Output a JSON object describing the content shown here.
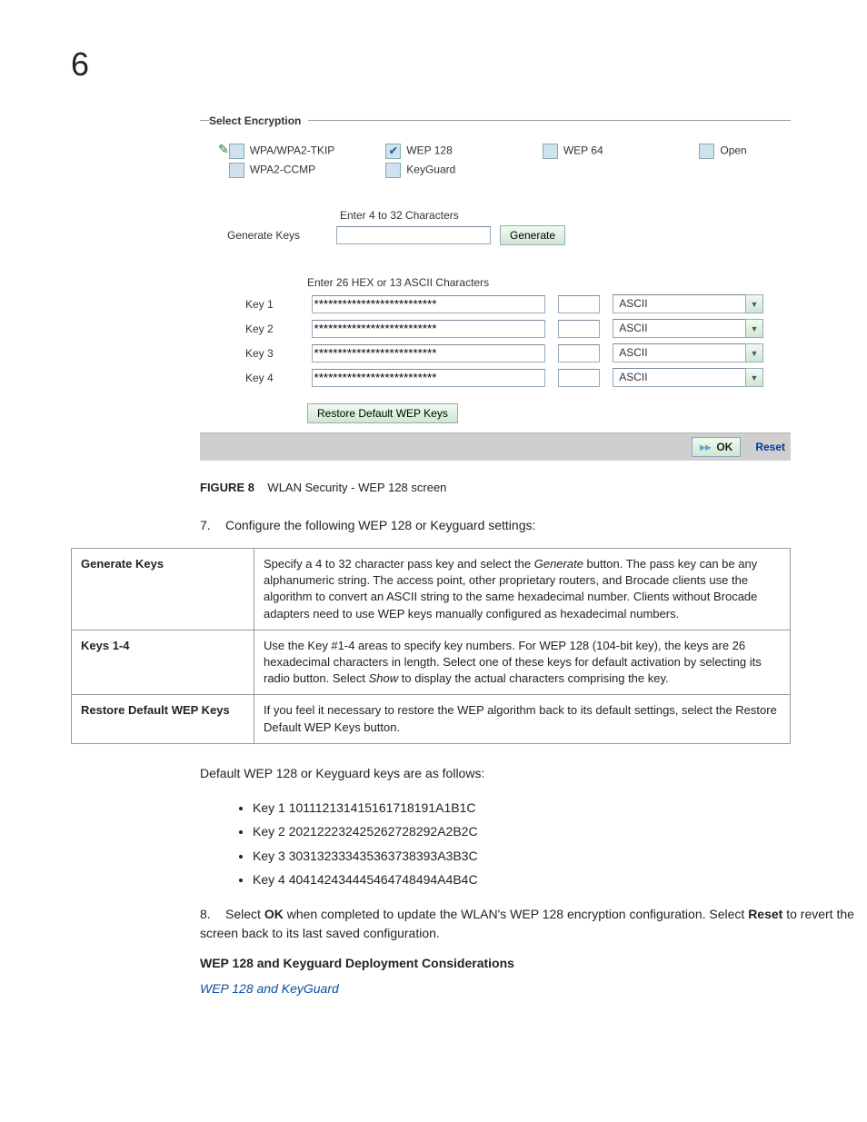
{
  "chapter": "6",
  "screenshot": {
    "fieldset_label": "Select Encryption",
    "enc_options": {
      "col1": [
        {
          "label": "WPA/WPA2-TKIP",
          "checked": false
        },
        {
          "label": "WPA2-CCMP",
          "checked": false
        }
      ],
      "col2": [
        {
          "label": "WEP 128",
          "checked": true
        },
        {
          "label": "KeyGuard",
          "checked": false
        }
      ],
      "col3": [
        {
          "label": "WEP 64",
          "checked": false
        }
      ],
      "col4": [
        {
          "label": "Open",
          "checked": false
        }
      ]
    },
    "gen_hint": "Enter 4 to 32 Characters",
    "gen_label": "Generate Keys",
    "gen_btn": "Generate",
    "keys_hint": "Enter 26 HEX or 13 ASCII Characters",
    "keys": [
      {
        "label": "Key 1",
        "value": "**************************",
        "type": "ASCII"
      },
      {
        "label": "Key 2",
        "value": "**************************",
        "type": "ASCII"
      },
      {
        "label": "Key 3",
        "value": "**************************",
        "type": "ASCII"
      },
      {
        "label": "Key 4",
        "value": "**************************",
        "type": "ASCII"
      }
    ],
    "restore_btn": "Restore Default WEP Keys",
    "ok_btn": "OK",
    "reset_btn": "Reset"
  },
  "figure": {
    "num": "FIGURE 8",
    "caption": "WLAN Security - WEP 128 screen"
  },
  "step7": {
    "num": "7.",
    "text": "Configure the following WEP 128 or Keyguard settings:"
  },
  "table": {
    "r1h": "Generate Keys",
    "r1t_a": "Specify a 4 to 32 character pass key and select the ",
    "r1t_b": "Generate",
    "r1t_c": " button. The pass key can be any alphanumeric string. The access point, other proprietary routers, and Brocade clients use the algorithm to convert an ASCII string to the same hexadecimal number. Clients without Brocade adapters need to use WEP keys manually configured as hexadecimal numbers.",
    "r2h": "Keys 1-4",
    "r2t_a": "Use the Key #1-4 areas to specify key numbers. For WEP 128 (104-bit key), the keys are 26 hexadecimal characters in length. Select one of these keys for default activation by selecting its radio button. Select ",
    "r2t_b": "Show",
    "r2t_c": " to display the actual characters comprising the key.",
    "r3h": "Restore Default WEP Keys",
    "r3t": "If you feel it necessary to restore the WEP algorithm back to its default settings, select the Restore Default WEP Keys button."
  },
  "defaults_intro": "Default WEP 128 or Keyguard keys are as follows:",
  "defaults": [
    "Key 1 101112131415161718191A1B1C",
    "Key 2 202122232425262728292A2B2C",
    "Key 3 303132333435363738393A3B3C",
    "Key 4 404142434445464748494A4B4C"
  ],
  "step8": {
    "num": "8.",
    "a": "Select ",
    "b": "OK",
    "c": " when completed to update the WLAN's WEP 128 encryption configuration. Select ",
    "d": "Reset",
    "e": " to revert the screen back to its last saved configuration."
  },
  "sub_heading": "WEP 128 and Keyguard Deployment Considerations",
  "link": "WEP 128 and KeyGuard"
}
